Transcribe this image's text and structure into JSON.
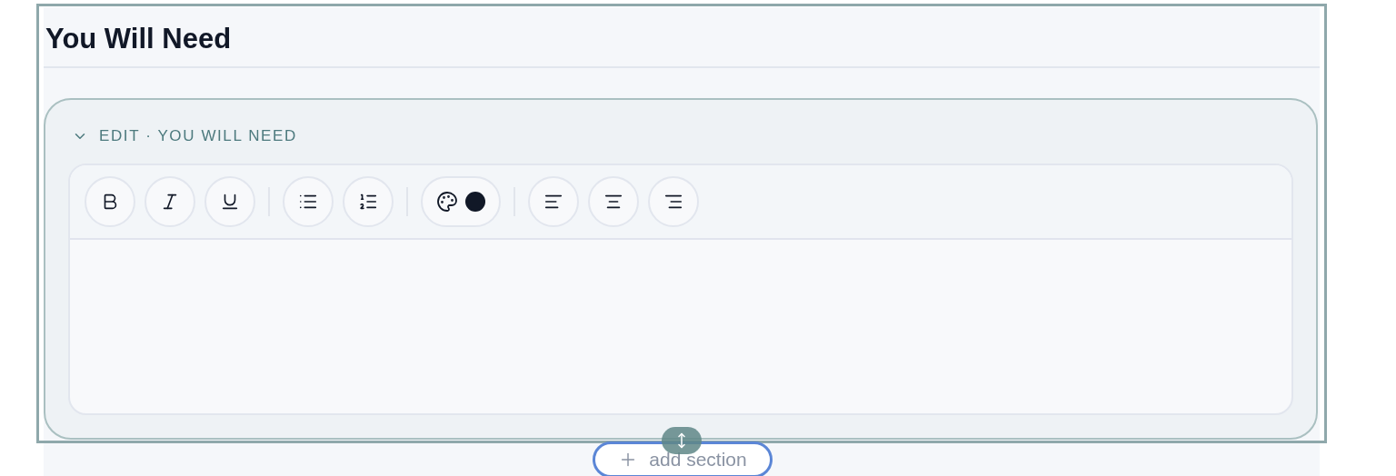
{
  "section": {
    "title": "You Will Need"
  },
  "editor": {
    "header": "EDIT · YOU WILL NEED",
    "expanded": true,
    "toolbar": [
      [
        {
          "kind": "bold"
        },
        {
          "kind": "italic"
        },
        {
          "kind": "underline"
        }
      ],
      [
        {
          "kind": "bullet-list"
        },
        {
          "kind": "numbered-list"
        }
      ],
      [
        {
          "kind": "color",
          "color": "#111827"
        }
      ],
      [
        {
          "kind": "align-left"
        },
        {
          "kind": "align-center"
        },
        {
          "kind": "align-right"
        }
      ]
    ]
  },
  "add_section": {
    "label": "add section"
  }
}
